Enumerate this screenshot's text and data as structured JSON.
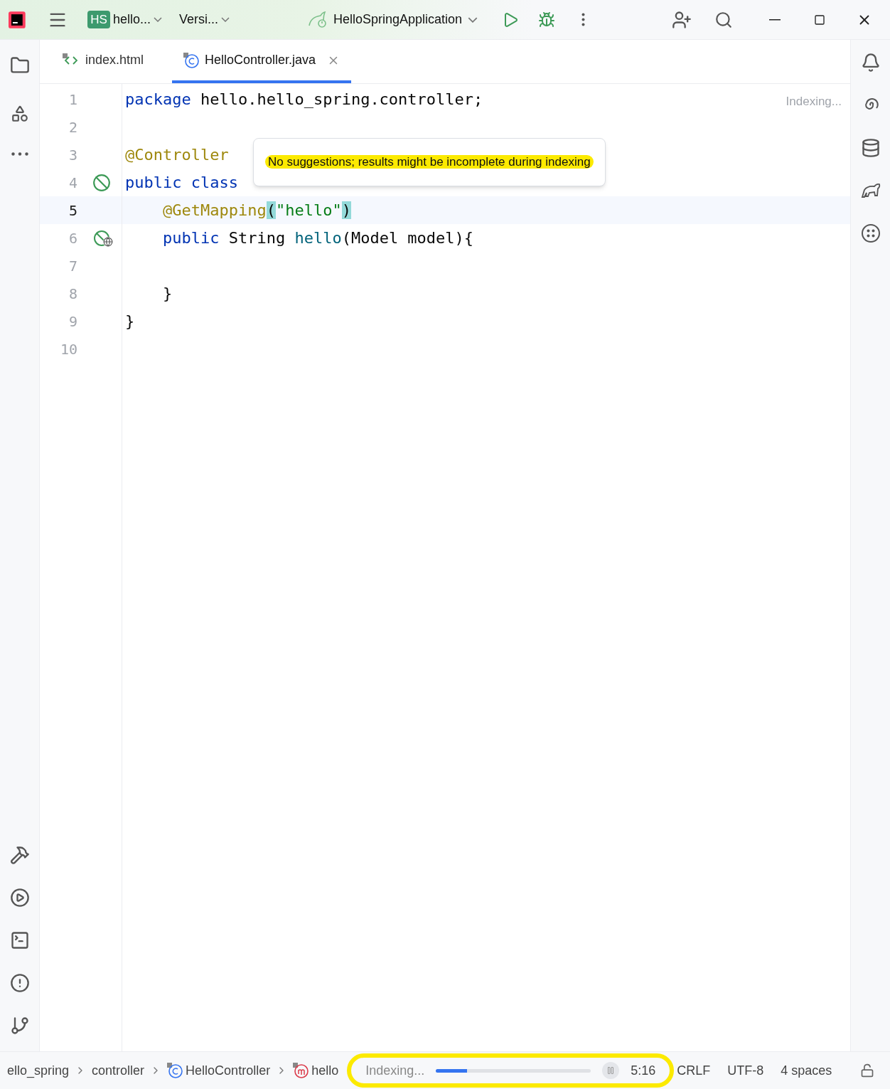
{
  "title_bar": {
    "project_badge": "HS",
    "project": "hello...",
    "vcs": "Versi...",
    "run_config": "HelloSpringApplication"
  },
  "tabs": [
    {
      "label": "index.html",
      "kind": "html",
      "selected": false,
      "closable": false
    },
    {
      "label": "HelloController.java",
      "kind": "class",
      "selected": true,
      "closable": true
    }
  ],
  "editor": {
    "indexing_hint": "Indexing...",
    "lines": [
      {
        "number": "1",
        "current": false,
        "tokens": [
          {
            "kind": "keyword",
            "text": "package"
          },
          {
            "kind": "plain",
            "text": " hello.hello_spring.controller;"
          }
        ]
      },
      {
        "number": "2",
        "current": false
      },
      {
        "number": "3",
        "current": false,
        "tokens": [
          {
            "kind": "annotation",
            "text": "@Controller"
          }
        ]
      },
      {
        "number": "4",
        "current": false,
        "gutter_icon": {
          "kind": "bean"
        },
        "tokens": [
          {
            "kind": "keyword",
            "text": "public class"
          }
        ]
      },
      {
        "number": "5",
        "current": true,
        "tokens": [
          {
            "kind": "annotation",
            "text": "    @GetMapping"
          },
          {
            "kind": "match",
            "text": "("
          },
          {
            "kind": "string",
            "text": "\"hello\""
          },
          {
            "kind": "match",
            "text": ")"
          }
        ]
      },
      {
        "number": "6",
        "current": false,
        "gutter_icon": {
          "kind": "web"
        },
        "tokens": [
          {
            "kind": "keyword",
            "text": "    public"
          },
          {
            "kind": "plain",
            "text": " String "
          },
          {
            "kind": "method",
            "text": "hello"
          },
          {
            "kind": "plain",
            "text": "(Model model){"
          }
        ]
      },
      {
        "number": "7",
        "current": false
      },
      {
        "number": "8",
        "current": false,
        "tokens": [
          {
            "kind": "plain",
            "text": "    }"
          }
        ]
      },
      {
        "number": "9",
        "current": false,
        "tokens": [
          {
            "kind": "plain",
            "text": "}"
          }
        ]
      },
      {
        "number": "10",
        "current": false
      }
    ]
  },
  "tooltip": {
    "text": "No suggestions; results might be incomplete during indexing",
    "highlighted": true
  },
  "breadcrumbs": [
    {
      "label": "ello_spring",
      "kind": "folder"
    },
    {
      "label": "controller",
      "kind": "folder"
    },
    {
      "label": "HelloController",
      "kind": "class"
    },
    {
      "label": "hello",
      "kind": "method"
    }
  ],
  "status_bar": {
    "highlighted": true,
    "progress_label": "Indexing...",
    "level": 0.2,
    "position": "5:16",
    "line_separator": "CRLF",
    "encoding": "UTF-8",
    "indent": "4 spaces"
  }
}
